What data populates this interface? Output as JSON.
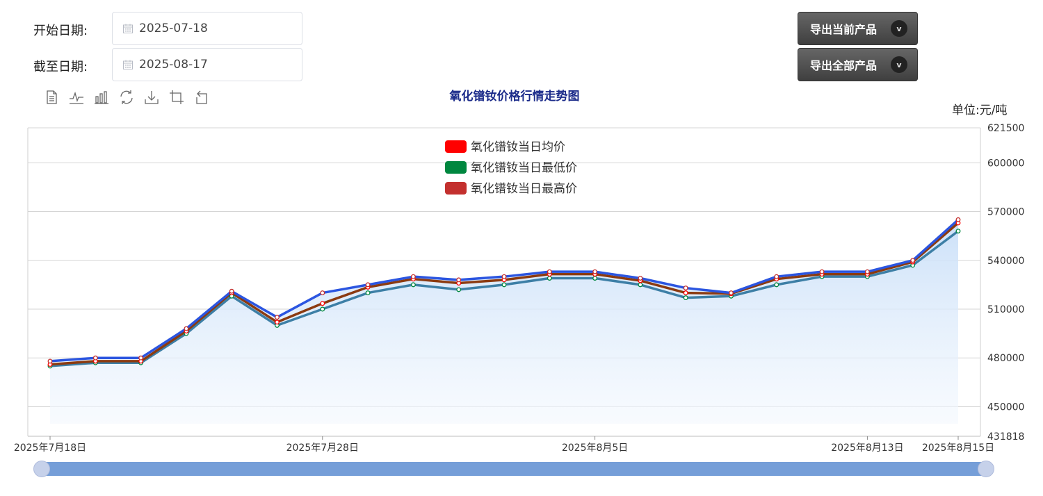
{
  "filters": {
    "start_label": "开始日期:",
    "start_value": "2025-07-18",
    "end_label": "截至日期:",
    "end_value": "2025-08-17"
  },
  "actions": {
    "export_current": "导出当前产品",
    "export_all": "导出全部产品",
    "chevron": "v"
  },
  "toolbar": [
    "data-view-icon",
    "line-chart-icon",
    "bar-chart-icon",
    "restore-icon",
    "download-icon",
    "zoom-icon",
    "zoom-reset-icon"
  ],
  "chart_data": {
    "type": "line",
    "title": "氧化镨钕价格行情走势图",
    "unit": "单位:元/吨",
    "ylim": [
      431818,
      621500
    ],
    "yticks": [
      621500,
      600000,
      570000,
      540000,
      510000,
      480000,
      450000,
      431818
    ],
    "x": [
      "2025-07-18",
      "2025-07-21",
      "2025-07-22",
      "2025-07-23",
      "2025-07-24",
      "2025-07-25",
      "2025-07-28",
      "2025-07-29",
      "2025-07-30",
      "2025-07-31",
      "2025-08-01",
      "2025-08-04",
      "2025-08-05",
      "2025-08-06",
      "2025-08-07",
      "2025-08-08",
      "2025-08-11",
      "2025-08-12",
      "2025-08-13",
      "2025-08-14",
      "2025-08-15"
    ],
    "xtick_labels": [
      {
        "index": 0,
        "label": "2025年7月18日"
      },
      {
        "index": 6,
        "label": "2025年7月28日"
      },
      {
        "index": 12,
        "label": "2025年8月5日"
      },
      {
        "index": 18,
        "label": "2025年8月13日"
      },
      {
        "index": 20,
        "label": "2025年8月15日"
      }
    ],
    "series": [
      {
        "name": "氧化镨钕当日均价",
        "color": "#ff0000",
        "line_color": "#8b3a10",
        "values": [
          476000,
          478000,
          478000,
          496500,
          520000,
          502000,
          513500,
          523500,
          528500,
          526000,
          528000,
          531500,
          531500,
          527500,
          520000,
          519500,
          528500,
          531500,
          531500,
          539000,
          563000
        ]
      },
      {
        "name": "氧化镨钕当日最低价",
        "color": "#00873f",
        "line_color": "#3d7fa6",
        "values": [
          475000,
          477000,
          477000,
          495000,
          518000,
          500000,
          510000,
          520000,
          525000,
          522000,
          525000,
          529000,
          529000,
          525000,
          517000,
          518000,
          525000,
          530000,
          530000,
          537000,
          558000
        ]
      },
      {
        "name": "氧化镨钕当日最高价",
        "color": "#c3302e",
        "line_color": "#2b55e0",
        "values": [
          478000,
          480000,
          480000,
          498000,
          521000,
          505000,
          520000,
          525000,
          530000,
          528000,
          530000,
          533000,
          533000,
          529000,
          523000,
          520000,
          530000,
          533000,
          533000,
          540000,
          565000
        ]
      }
    ],
    "legend_position": "top-center",
    "grid": true,
    "area_fill": true
  },
  "slider": {
    "start": 0,
    "end": 100
  }
}
